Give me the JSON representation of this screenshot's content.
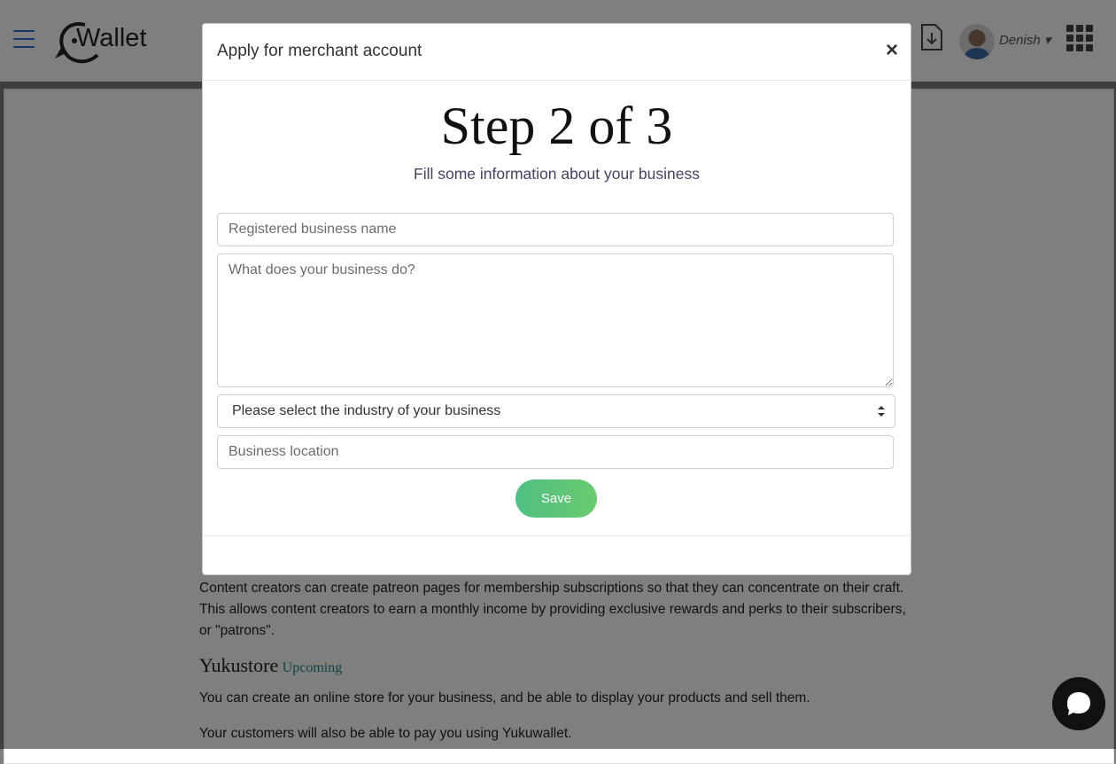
{
  "header": {
    "logo_text": "Wallet",
    "username": "Denish",
    "icons": [
      "hamburger-menu-icon",
      "download-icon",
      "user-avatar",
      "apps-grid-icon"
    ]
  },
  "background": {
    "paragraph_patreon": "Content creators can create patreon pages for membership subscriptions so that they can concentrate on their craft. This allows content creators to earn a monthly income by providing exclusive rewards and perks to their subscribers, or \"patrons\".",
    "yukustore_title": "Yukustore",
    "yukustore_badge": "Upcoming",
    "yukustore_p1": "You can create an online store for your business, and be able to display your products and sell them.",
    "yukustore_p2": "Your customers will also be able to pay you using Yukuwallet."
  },
  "modal": {
    "title": "Apply for merchant account",
    "close": "×",
    "step": "Step 2 of 3",
    "subtitle": "Fill some information about your business",
    "business_name_placeholder": "Registered business name",
    "business_do_placeholder": "What does your business do?",
    "industry_select": "Please select the industry of your business",
    "location_placeholder": "Business location",
    "save_label": "Save"
  },
  "colors": {
    "accent_blue": "#2a6fd4",
    "save_green": "#5cc47a",
    "subtitle_purple": "#4a4060",
    "upcoming_teal": "#1a8a8a"
  }
}
